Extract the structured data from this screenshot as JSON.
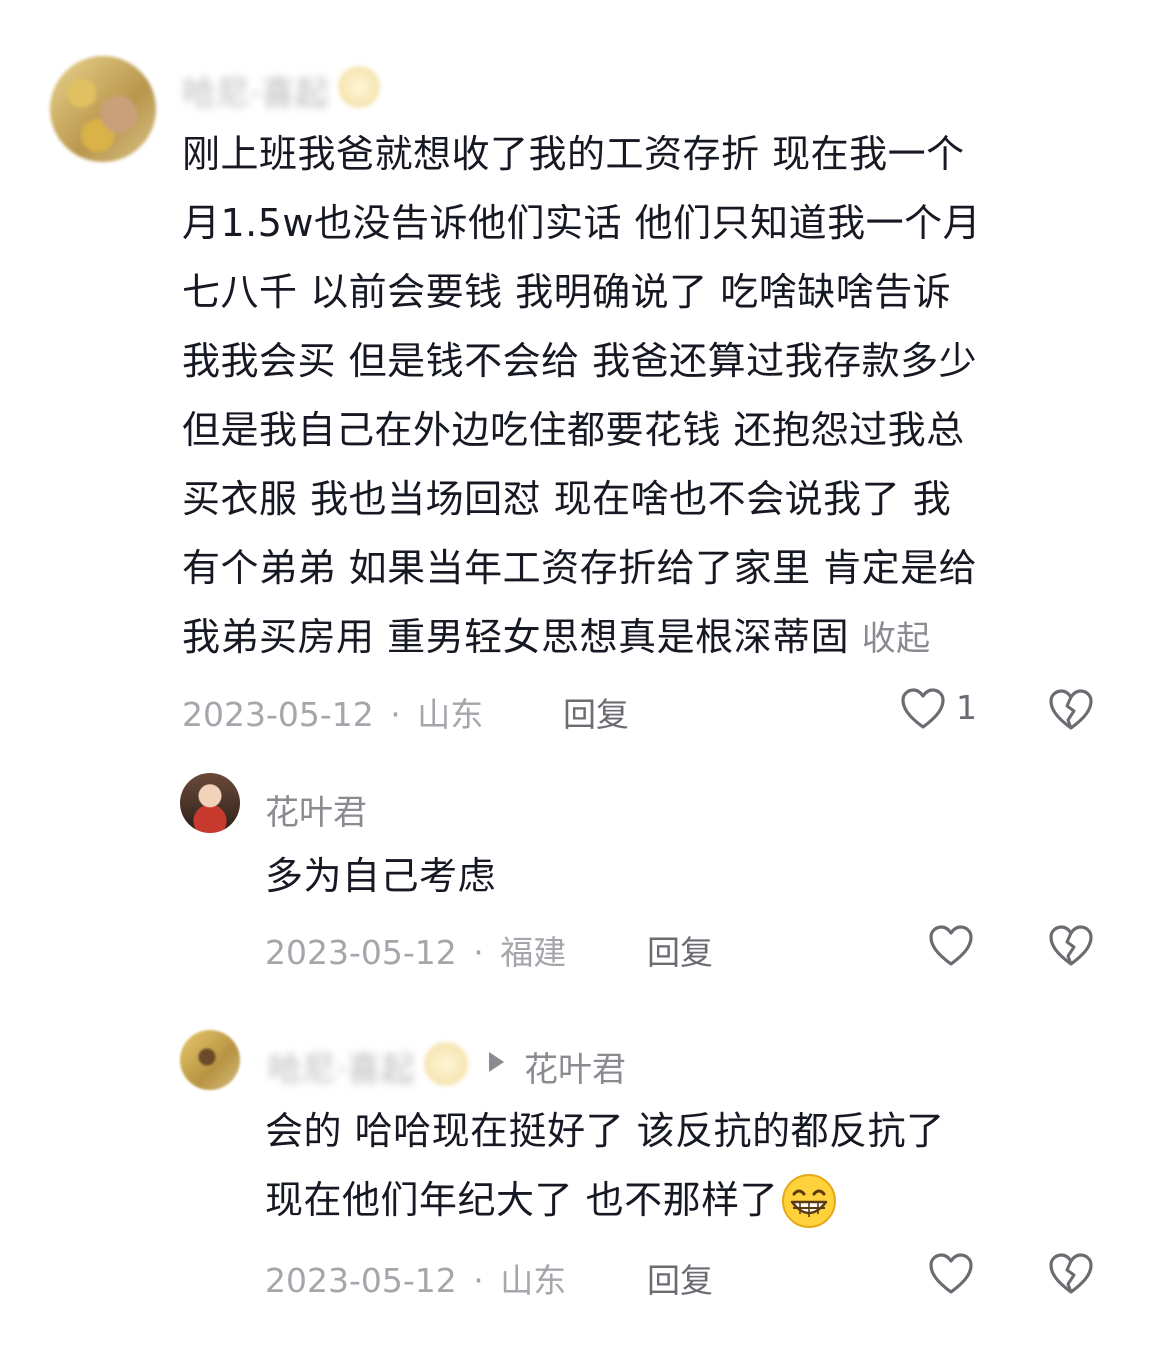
{
  "comment": {
    "author": "哈尼·喜起",
    "lines": [
      "刚上班我爸就想收了我的工资存折 现在我一个",
      "月1.5w也没告诉他们实话 他们只知道我一个月",
      "七八千 以前会要钱 我明确说了 吃啥缺啥告诉",
      "我我会买 但是钱不会给 我爸还算过我存款多少",
      "但是我自己在外边吃住都要花钱 还抱怨过我总",
      "买衣服 我也当场回怼 现在啥也不会说我了  我",
      "有个弟弟 如果当年工资存折给了家里 肯定是给"
    ],
    "last_line": "我弟买房用 重男轻女思想真是根深蒂固",
    "collapse_label": "收起",
    "date": "2023-05-12",
    "location": "山东",
    "reply_label": "回复",
    "like_count": "1"
  },
  "reply1": {
    "author": "花叶君",
    "text": "多为自己考虑",
    "date": "2023-05-12",
    "location": "福建",
    "reply_label": "回复"
  },
  "reply2": {
    "author": "哈尼·喜起",
    "reply_to": "花叶君",
    "lines": [
      "会的 哈哈现在挺好了 该反抗的都反抗了",
      "现在他们年纪大了 也不那样了"
    ],
    "date": "2023-05-12",
    "location": "山东",
    "reply_label": "回复"
  },
  "dot": "·",
  "icons": {
    "like": "heart-outline-icon",
    "dislike": "broken-heart-icon",
    "arrow": "triangle-right-icon",
    "emoji": "grinning-face-icon"
  }
}
